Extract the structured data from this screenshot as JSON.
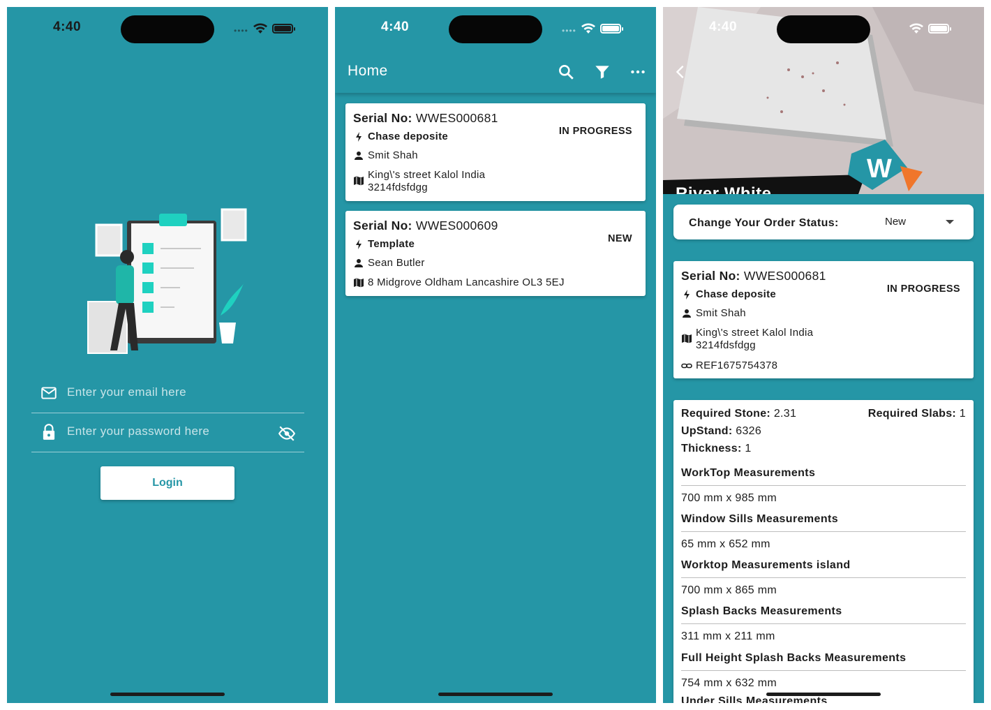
{
  "status_bar": {
    "time": "4:40"
  },
  "login": {
    "email_placeholder": "Enter your email here",
    "password_placeholder": "Enter your password here",
    "login_label": "Login"
  },
  "home": {
    "title": "Home",
    "icons": [
      "search-icon",
      "filter-icon",
      "more-icon"
    ],
    "orders": [
      {
        "serial_label": "Serial No:",
        "serial": "WWES000681",
        "template": "Chase deposite",
        "customer": "Smit Shah",
        "address": "King\\'s street Kalol India 3214fdsfdgg",
        "status": "IN PROGRESS"
      },
      {
        "serial_label": "Serial No:",
        "serial": "WWES000609",
        "template": "Template",
        "customer": "Sean Butler",
        "address": "8 Midgrove Oldham Lancashire OL3 5EJ",
        "status": "NEW"
      }
    ]
  },
  "detail": {
    "hero_title": "River White",
    "status_label": "Change Your Order Status:",
    "status_value": "New",
    "order": {
      "serial_label": "Serial No:",
      "serial": "WWES000681",
      "template": "Chase deposite",
      "customer": "Smit Shah",
      "address": "King\\'s street Kalol India 3214fdsfdgg",
      "reference": "REF1675754378",
      "status": "IN PROGRESS"
    },
    "specs": {
      "required_stone_label": "Required Stone:",
      "required_stone": "2.31",
      "required_slabs_label": "Required Slabs:",
      "required_slabs": "1",
      "upstand_label": "UpStand:",
      "upstand": "6326",
      "thickness_label": "Thickness:",
      "thickness": "1"
    },
    "measurements": [
      {
        "title": "WorkTop Measurements",
        "value": "700 mm x 985 mm"
      },
      {
        "title": "Window Sills Measurements",
        "value": "65 mm x 652 mm"
      },
      {
        "title": "Worktop Measurements island",
        "value": "700 mm x 865 mm"
      },
      {
        "title": "Splash Backs Measurements",
        "value": "311 mm x 211 mm"
      },
      {
        "title": "Full Height Splash Backs Measurements",
        "value": "754 mm x 632 mm"
      },
      {
        "title": "Under Sills Measurements",
        "value": ""
      }
    ]
  },
  "colors": {
    "teal": "#2596a6",
    "card": "#ffffff",
    "accent": "#1fd1c0"
  }
}
